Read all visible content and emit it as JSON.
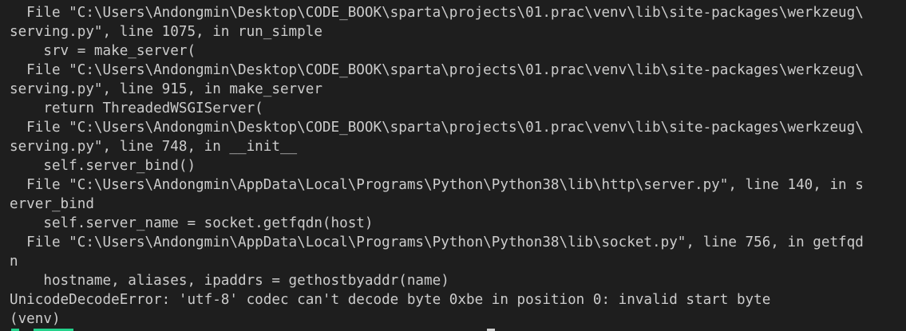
{
  "terminal": {
    "lines": [
      "  File \"C:\\Users\\Andongmin\\Desktop\\CODE_BOOK\\sparta\\projects\\01.prac\\venv\\lib\\site-packages\\werkzeug\\",
      "serving.py\", line 1075, in run_simple",
      "    srv = make_server(",
      "  File \"C:\\Users\\Andongmin\\Desktop\\CODE_BOOK\\sparta\\projects\\01.prac\\venv\\lib\\site-packages\\werkzeug\\",
      "serving.py\", line 915, in make_server",
      "    return ThreadedWSGIServer(",
      "  File \"C:\\Users\\Andongmin\\Desktop\\CODE_BOOK\\sparta\\projects\\01.prac\\venv\\lib\\site-packages\\werkzeug\\",
      "serving.py\", line 748, in __init__",
      "    self.server_bind()",
      "  File \"C:\\Users\\Andongmin\\AppData\\Local\\Programs\\Python\\Python38\\lib\\http\\server.py\", line 140, in s",
      "erver_bind",
      "    self.server_name = socket.getfqdn(host)",
      "  File \"C:\\Users\\Andongmin\\AppData\\Local\\Programs\\Python\\Python38\\lib\\socket.py\", line 756, in getfqd",
      "n",
      "    hostname, aliases, ipaddrs = gethostbyaddr(name)",
      "UnicodeDecodeError: 'utf-8' codec can't decode byte 0xbe in position 0: invalid start byte",
      "(venv)"
    ]
  }
}
